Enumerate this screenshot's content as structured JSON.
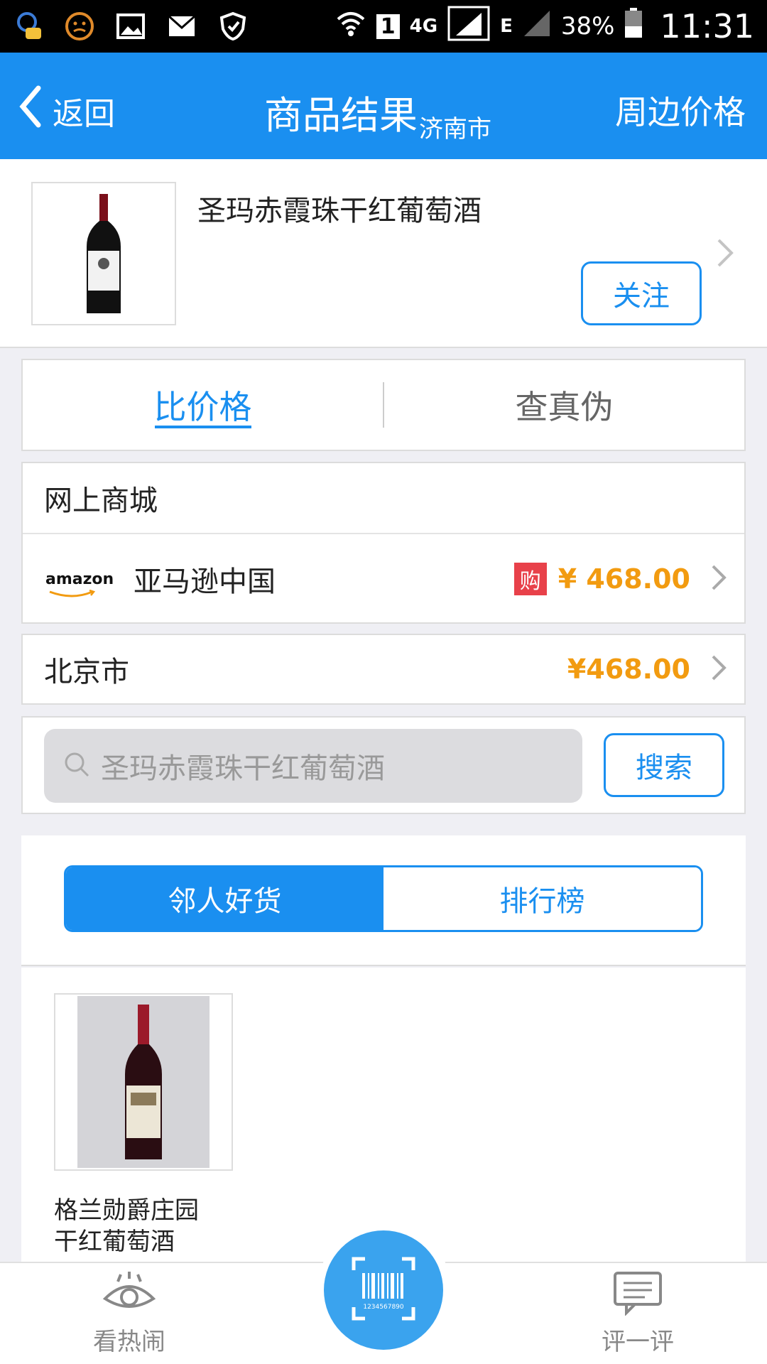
{
  "status_bar": {
    "network": "4G",
    "sim_slot": "1",
    "data_type": "E",
    "battery": "38%",
    "time": "11:31"
  },
  "nav": {
    "back_label": "返回",
    "title": "商品结果",
    "city": "济南市",
    "right_label": "周边价格"
  },
  "product": {
    "name": "圣玛赤霞珠干红葡萄酒",
    "follow_label": "关注"
  },
  "tabs": {
    "compare": "比价格",
    "verify": "查真伪"
  },
  "online": {
    "section_title": "网上商城",
    "shops": [
      {
        "logo": "amazon",
        "name": "亚马逊中国",
        "badge": "购",
        "price": "¥ 468.00"
      }
    ]
  },
  "city_price": {
    "city": "北京市",
    "price": "¥468.00"
  },
  "search": {
    "placeholder": "圣玛赤霞珠干红葡萄酒",
    "button": "搜索"
  },
  "segment": {
    "left": "邻人好货",
    "right": "排行榜"
  },
  "goods": [
    {
      "name_line1": "格兰勋爵庄园",
      "name_line2": "干红葡萄酒"
    }
  ],
  "bottom_bar": {
    "left_label": "看热闹",
    "right_label": "评一评",
    "barcode_digits": "1234567890"
  },
  "colors": {
    "primary": "#1a8ff0",
    "price": "#f29b10",
    "badge": "#e8414a"
  }
}
